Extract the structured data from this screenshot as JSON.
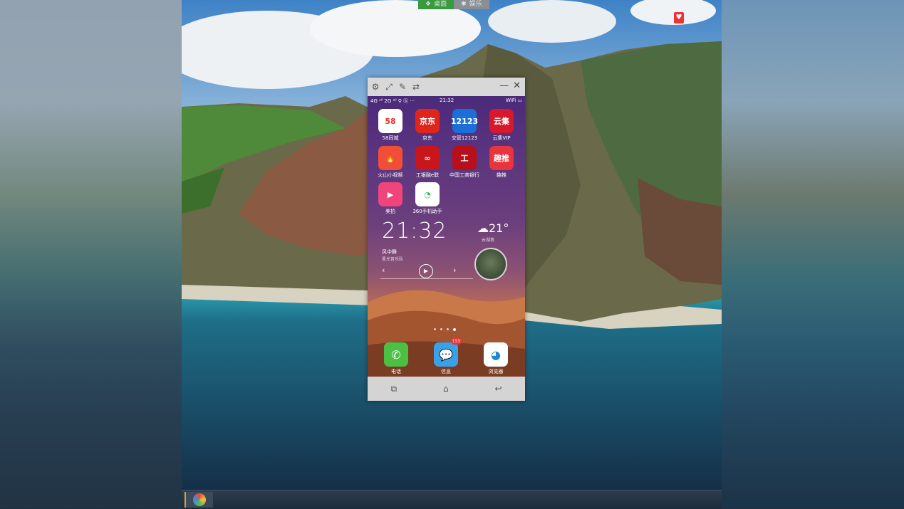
{
  "top_tabs": [
    {
      "label": "桌面",
      "active": true
    },
    {
      "label": "娱乐",
      "active": false
    }
  ],
  "phone": {
    "toolbar": {
      "tools": [
        "settings-icon",
        "fullscreen-icon",
        "pen-icon",
        "rotate-icon"
      ],
      "minimize": "—",
      "close": "✕"
    },
    "status_bar": {
      "left": "4G ᵃˡˡ   2G ᵃˡˡ  ⚲ ⓑ ···",
      "time": "21:32",
      "right": "WiFi ▭"
    },
    "apps": [
      {
        "name": "58同城",
        "icon_text": "58",
        "color": "#ffffff",
        "text_color": "#e8322b"
      },
      {
        "name": "京东",
        "icon_text": "京东",
        "color": "#e1251b"
      },
      {
        "name": "交管12123",
        "icon_text": "12123",
        "color": "#1d6fd8"
      },
      {
        "name": "云集VIP",
        "icon_text": "云集",
        "color": "#d8182c"
      },
      {
        "name": "火山小视频",
        "icon_text": "🔥",
        "color": "#f04e37"
      },
      {
        "name": "工银融e联",
        "icon_text": "∞",
        "color": "#c8161d"
      },
      {
        "name": "中国工商银行",
        "icon_text": "工",
        "color": "#b80f1a"
      },
      {
        "name": "趣推",
        "icon_text": "趣推",
        "color": "#e8343c"
      },
      {
        "name": "美拍",
        "icon_text": "▶",
        "color": "#f0457b"
      },
      {
        "name": "360手机助手",
        "icon_text": "◔",
        "color": "#ffffff",
        "text_color": "#3cb64a"
      }
    ],
    "clock": "21:32",
    "weather": {
      "temp": "21°",
      "location": "云湖巷"
    },
    "music": {
      "title": "风中舞",
      "artist": "星光音乐队",
      "prev": "‹",
      "play": "▶",
      "next": "›"
    },
    "dock": [
      {
        "name": "电话",
        "icon_text": "✆",
        "color": "#4bc144"
      },
      {
        "name": "信息",
        "icon_text": "💬",
        "color": "#3aa1e8",
        "badge": "153"
      },
      {
        "name": "浏览器",
        "icon_text": "◕",
        "color": "#ffffff",
        "text_color": "#1e88d0"
      }
    ],
    "navbar": {
      "recent": "⧉",
      "home": "⌂",
      "back": "↩"
    }
  },
  "colors": {
    "tab_active": "#3a9a3f",
    "tab_inactive": "#8a8f94"
  }
}
